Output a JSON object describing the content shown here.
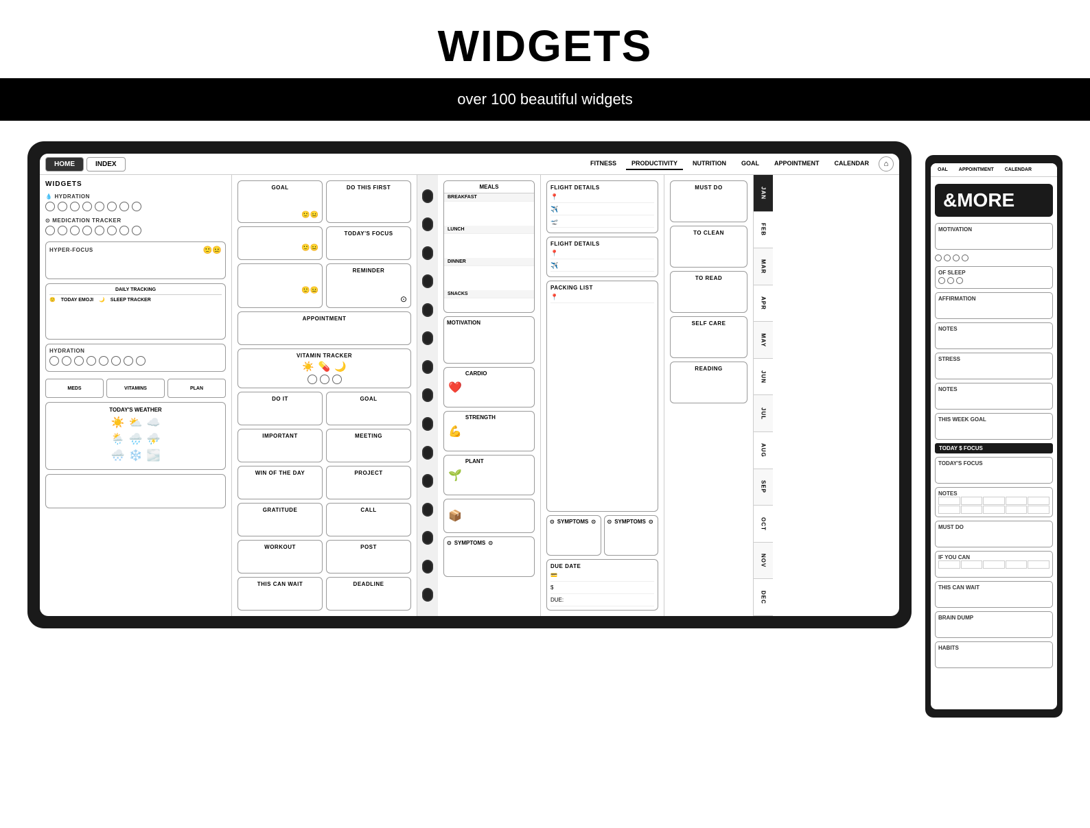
{
  "header": {
    "title": "WIDGETS",
    "subtitle": "over 100 beautiful widgets"
  },
  "nav": {
    "left_tabs": [
      "HOME",
      "INDEX"
    ],
    "right_tabs": [
      "FITNESS",
      "PRODUCTIVITY",
      "NUTRITION",
      "GOAL",
      "APPOINTMENT",
      "CALENDAR"
    ],
    "home_icon": "⌂"
  },
  "left_panel": {
    "section_title": "WIDGETS",
    "hydration_label": "HYDRATION",
    "medication_label": "MEDICATION TRACKER",
    "hyper_focus_label": "HYPER-FOCUS",
    "daily_tracking_label": "DAILY TRACKING",
    "today_emoji_label": "TODAY EMOJI",
    "sleep_tracker_label": "SLEEP TRACKER",
    "hydration2_label": "HYDRATION",
    "meds_label": "MEDS",
    "vitamins_label": "VITAMINS",
    "plan_label": "PLAN",
    "weather_label": "TODAY'S WEATHER"
  },
  "middle_panel": {
    "goal_label": "GOAL",
    "do_this_first_label": "DO THIS FIRST",
    "todays_focus_label": "TODAY'S FOCUS",
    "reminder_label": "REMINDER",
    "appointment_label": "APPOINTMENT",
    "vitamin_tracker_label": "VITAMIN TRACKER",
    "do_it_label": "DO IT",
    "goal2_label": "GOAL",
    "important_label": "IMPORTANT",
    "meeting_label": "MEETING",
    "win_of_day_label": "WIN OF THE DAY",
    "project_label": "PROJECT",
    "gratitude_label": "GRATITUDE",
    "call_label": "CALL",
    "workout_label": "WORKOUT",
    "post_label": "POST",
    "this_can_wait_label": "THIS CAN WAIT",
    "deadline_label": "DEADLINE"
  },
  "nutrition_panel": {
    "meals_label": "MEALS",
    "breakfast_label": "BREAKFAST",
    "lunch_label": "LUNCH",
    "dinner_label": "DINNER",
    "snacks_label": "SNACKS",
    "motivation_label": "MOTIVATION",
    "cardio_label": "CARDIO",
    "strength_label": "STRENGTH",
    "plant_label": "PLANT",
    "cube_label": "CUBE",
    "symptoms_label": "SYMPTOMS"
  },
  "flight_panel": {
    "flight_details1": "FLIGHT DETAILS",
    "flight_details2": "FLIGHT DETAILS",
    "packing_list": "PACKING LIST",
    "symptoms1": "SYMPTOMS",
    "symptoms2": "SYMPTOMS",
    "due_date": "DUE DATE",
    "dollar_symbol": "$",
    "due_label": "DUE:"
  },
  "task_panel": {
    "must_do": "MUST DO",
    "to_clean": "TO CLEAN",
    "clean_label": "CLEAN",
    "to_read": "TO READ",
    "self_care": "SELF CARE",
    "reading": "READING",
    "this_week_goal": "THIS WEEK GOAL",
    "todays_focus": "TODAY'S FOCUS",
    "must_do2": "MUST DO",
    "if_you_can": "IF YOU CAN",
    "this_can_wait": "THIS CAN WAIT",
    "brain_dump": "BRAIN DUMP",
    "habits": "HABITS"
  },
  "months": [
    "JAN",
    "FEB",
    "MAR",
    "APR",
    "MAY",
    "JUN",
    "JUL",
    "AUG",
    "SEP",
    "OCT",
    "NOV",
    "DEC"
  ],
  "side_panel": {
    "more_label": "&MORE",
    "tabs": [
      "OAL",
      "APPOINTMENT",
      "CALENDAR"
    ],
    "motivation_label": "MOTIVATION",
    "affirmation_label": "AFFIRMATION",
    "notes_label": "NOTES",
    "stress_label": "STRESS",
    "of_sleep_label": "OF SLEEP",
    "this_week_goal_label": "THIS WEEK GOAL",
    "todays_focus_label": "TODAY'S FOCUS",
    "must_do_label": "MUST DO",
    "if_you_can_label": "IF YOU CAN",
    "this_can_wait_label": "THIS CAN WAIT",
    "brain_dump_label": "BRAIN DUMP",
    "habits_label": "HABITS",
    "today_focus_corner": "TODAY $ FOCUS"
  },
  "icons": {
    "drop": "💧",
    "pill": "💊",
    "sun": "☀️",
    "cloud_sun": "⛅",
    "cloud": "☁️",
    "rain": "🌧️",
    "snow": "❄️",
    "storm": "⛈️",
    "heart": "❤️",
    "pin": "📍",
    "plane": "✈️",
    "plant": "🌱",
    "cube": "📦",
    "fitness": "💪",
    "cardio": "❤️"
  }
}
